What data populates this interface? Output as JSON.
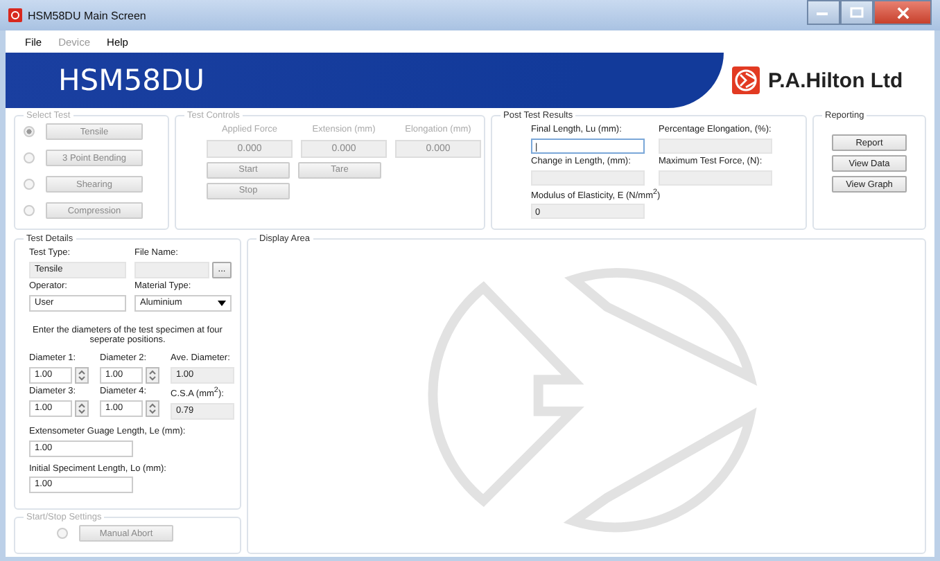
{
  "window": {
    "title": "HSM58DU Main Screen"
  },
  "menu": [
    {
      "label": "File",
      "disabled": false
    },
    {
      "label": "Device",
      "disabled": true
    },
    {
      "label": "Help",
      "disabled": false
    }
  ],
  "banner": {
    "product": "HSM58DU",
    "company": "P.A.Hilton Ltd"
  },
  "select_test": {
    "title": "Select Test",
    "disabled": true,
    "options": [
      {
        "label": "Tensile",
        "selected": true
      },
      {
        "label": "3 Point Bending",
        "selected": false
      },
      {
        "label": "Shearing",
        "selected": false
      },
      {
        "label": "Compression",
        "selected": false
      }
    ]
  },
  "test_controls": {
    "title": "Test Controls",
    "disabled": true,
    "readouts": [
      {
        "label": "Applied Force",
        "value": "0.000"
      },
      {
        "label": "Extension (mm)",
        "value": "0.000"
      },
      {
        "label": "Elongation (mm)",
        "value": "0.000"
      }
    ],
    "buttons": [
      "Start",
      "Tare",
      "Stop"
    ]
  },
  "post_test_results": {
    "title": "Post Test Results",
    "fields": [
      {
        "label": "Final Length, Lu (mm):",
        "value": "|",
        "focused": true
      },
      {
        "label": "Percentage Elongation, (%):",
        "focused": false
      },
      {
        "label": "Change in Length, (mm):",
        "focused": false
      },
      {
        "label": "Maximum Test Force, (N):",
        "focused": false
      },
      {
        "label": "Modulus of Elasticity, E (N/mm$^{2}$)",
        "value": "0",
        "focused": false
      }
    ]
  },
  "reporting": {
    "title": "Reporting",
    "buttons": [
      "Report",
      "View Data",
      "View Graph"
    ]
  },
  "test_details": {
    "title": "Test Details",
    "top_fields": [
      {
        "label": "Test Type:",
        "value": "Tensile",
        "kind": "readonly"
      },
      {
        "label": "File Name:",
        "kind": "file",
        "browse": "..."
      },
      {
        "label": "Operator:",
        "value": "User",
        "kind": "text"
      },
      {
        "label": "Material Type:",
        "value": "Aluminium",
        "kind": "dropdown"
      }
    ],
    "instruction": "Enter the diameters of the test specimen at four seperate positions.",
    "diameters": [
      {
        "label": "Diameter 1:",
        "value": "1.00",
        "kind": "spinner"
      },
      {
        "label": "Diameter 2:",
        "value": "1.00",
        "kind": "spinner"
      },
      {
        "label": "Ave. Diameter:",
        "value": "1.00",
        "kind": "readonly"
      },
      {
        "label": "Diameter 3:",
        "value": "1.00",
        "kind": "spinner"
      },
      {
        "label": "Diameter 4:",
        "value": "1.00",
        "kind": "spinner"
      },
      {
        "label": "C.S.A (mm$^{2}$):",
        "value": "0.79",
        "kind": "readonly"
      }
    ],
    "lengths": [
      {
        "label": "Extensometer Guage Length, Le (mm):",
        "value": "1.00"
      },
      {
        "label": "Initial Speciment Length, Lo (mm):",
        "value": "1.00"
      }
    ]
  },
  "start_stop_settings": {
    "title": "Start/Stop Settings",
    "disabled": true,
    "button": "Manual Abort",
    "selected": false
  },
  "display_area": {
    "title": "Display Area"
  }
}
